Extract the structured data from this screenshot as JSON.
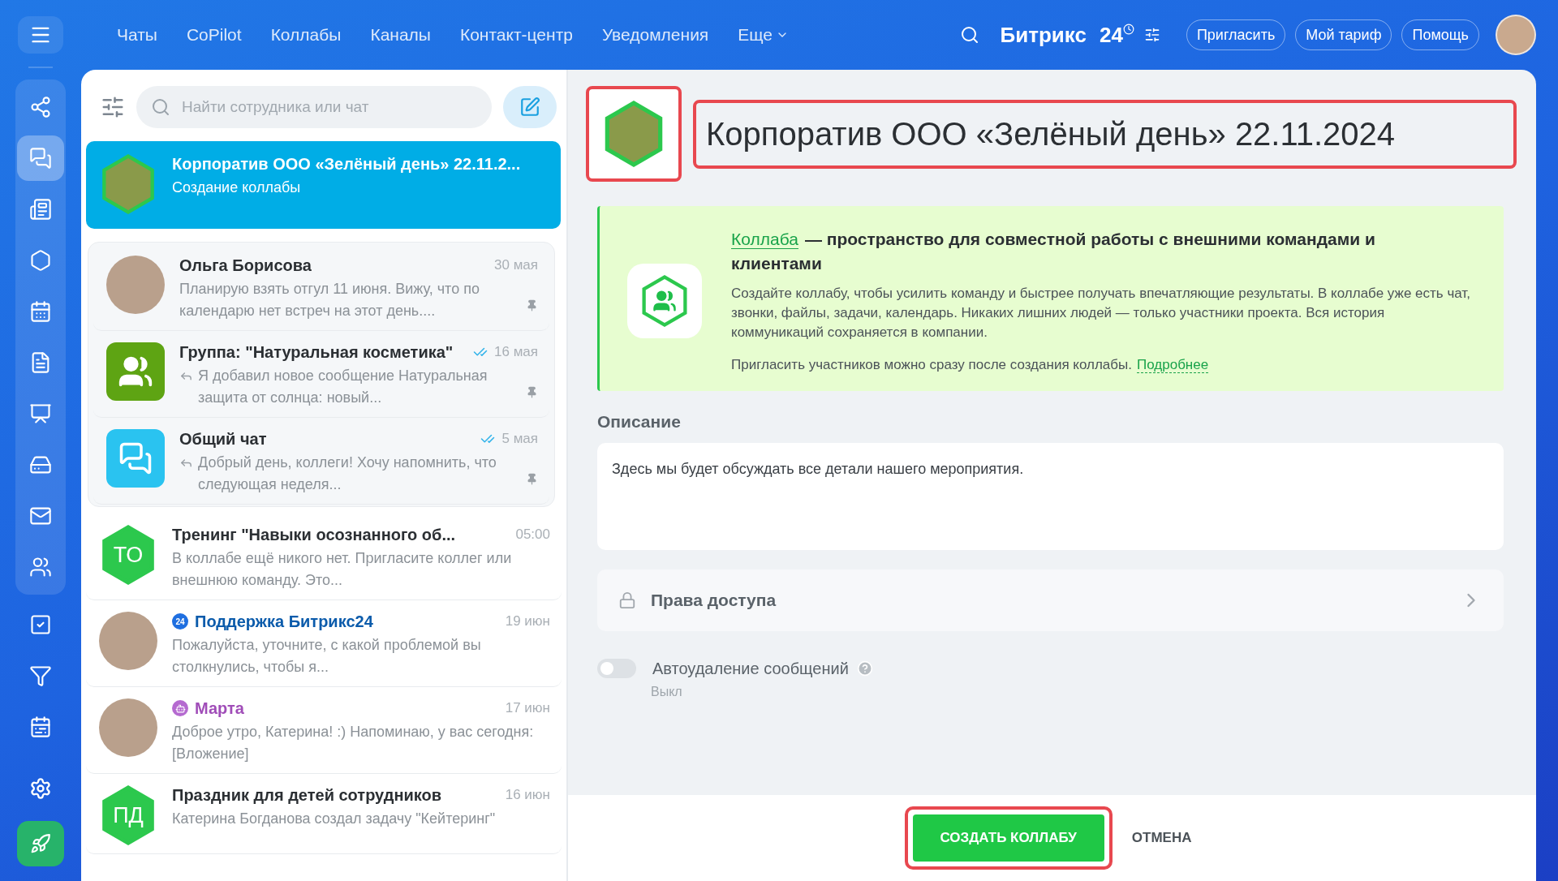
{
  "topbar": {
    "nav": [
      {
        "label": "Чаты",
        "dropdown": false
      },
      {
        "label": "CoPilot",
        "dropdown": false
      },
      {
        "label": "Коллабы",
        "dropdown": false
      },
      {
        "label": "Каналы",
        "dropdown": false
      },
      {
        "label": "Контакт-центр",
        "dropdown": false
      },
      {
        "label": "Уведомления",
        "dropdown": false
      },
      {
        "label": "Еще",
        "dropdown": true
      }
    ],
    "logo": {
      "name": "Битрикс",
      "number": "24"
    },
    "buttons": [
      "Пригласить",
      "Мой тариф",
      "Помощь"
    ]
  },
  "sidebar": {
    "items": [
      {
        "selected": false
      },
      {
        "selected": true
      },
      {
        "selected": false
      },
      {
        "selected": false
      },
      {
        "selected": false
      },
      {
        "selected": false
      },
      {
        "selected": false
      },
      {
        "selected": false
      },
      {
        "selected": false
      },
      {
        "selected": false
      },
      {
        "selected": false
      },
      {
        "selected": false
      },
      {
        "selected": false
      }
    ]
  },
  "chat_list": {
    "search": {
      "placeholder": "Найти сотрудника или чат"
    },
    "draft": [
      {
        "name": "Корпоратив ООО «Зелёный день» 22.11.2...",
        "preview": "Создание коллабы",
        "kind": "collab",
        "selected": true
      }
    ],
    "pinned": [
      {
        "name": "Ольга Борисова",
        "preview": "Планирую взять отгул 11 июня. Вижу, что по календарю нет встреч на этот день....",
        "time": "30 мая",
        "kind": "person",
        "selected": false,
        "pinned": true,
        "read": false,
        "reply": false
      },
      {
        "name": "Группа: \"Натуральная косметика\"",
        "preview": "Я добавил новое сообщение Натуральная защита от солнца: новый...",
        "time": "16 мая",
        "kind": "group",
        "selected": false,
        "pinned": true,
        "read": true,
        "reply": true
      },
      {
        "name": "Общий чат",
        "preview": "Добрый день, коллеги! Хочу напомнить, что следующая неделя...",
        "time": "5 мая",
        "kind": "chat",
        "selected": false,
        "pinned": true,
        "read": true,
        "reply": true
      }
    ],
    "chats": [
      {
        "name": "Тренинг \"Навыки осознанного об...",
        "preview": "В коллабе ещё никого нет. Пригласите коллег или внешнюю команду. Это...",
        "time": "05:00",
        "kind": "initials",
        "initials": "ТО",
        "selected": false
      },
      {
        "name": "Поддержка Битрикс24",
        "preview": "Пожалуйста, уточните, с какой проблемой вы столкнулись, чтобы я...",
        "time": "19 июн",
        "kind": "support",
        "badge_text": "24",
        "selected": false
      },
      {
        "name": "Марта",
        "preview": "Доброе утро, Катерина! :) Напоминаю, у вас сегодня: [Вложение]",
        "time": "17 июн",
        "kind": "bot",
        "selected": false
      },
      {
        "name": "Праздник для детей сотрудников",
        "preview": "Катерина Богданова создал задачу \"Кейтеринг\"",
        "time": "16 июн",
        "kind": "initials",
        "initials": "ПД",
        "selected": false
      }
    ]
  },
  "form": {
    "title": "Корпоратив ООО «Зелёный день» 22.11.2024",
    "title_highlighted": true,
    "avatar_highlighted": true,
    "info": {
      "link": "Коллаба",
      "heading": "— пространство для совместной работы с внешними командами и клиентами",
      "text": "Создайте коллабу, чтобы усилить команду и быстрее получать впечатляющие результаты. В коллабе уже есть чат, звонки, файлы, задачи, календарь. Никаких лишних людей — только участники проекта. Вся история коммуникаций сохраняется в компании.",
      "note": "Пригласить участников можно сразу после создания коллабы.",
      "note_link": "Подробнее"
    },
    "description_label": "Описание",
    "description": "Здесь мы будет обсуждать все детали нашего мероприятия.",
    "access": "Права доступа",
    "autodelete": {
      "label": "Автоудаление сообщений",
      "on": false,
      "status": "Выкл"
    },
    "create_button": {
      "label": "СОЗДАТЬ КОЛЛАБУ",
      "highlighted": true
    },
    "cancel_button": "ОТМЕНА"
  }
}
